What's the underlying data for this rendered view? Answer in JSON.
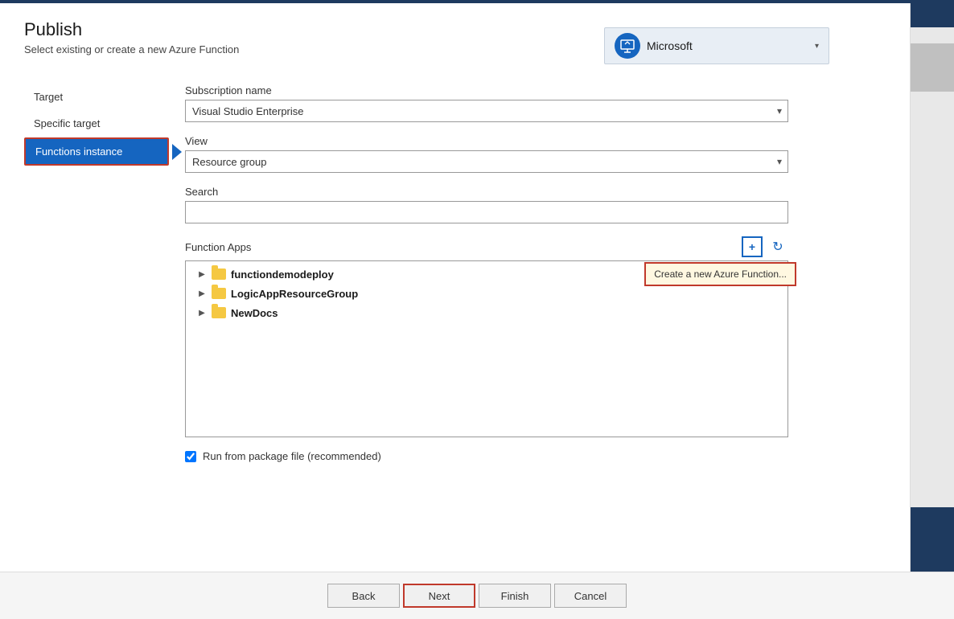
{
  "header": {
    "title": "Publish",
    "subtitle": "Select existing or create a new Azure Function",
    "account_name": "Microsoft",
    "account_icon": "👤"
  },
  "nav": {
    "items": [
      {
        "id": "target",
        "label": "Target"
      },
      {
        "id": "specific-target",
        "label": "Specific target"
      },
      {
        "id": "functions-instance",
        "label": "Functions instance",
        "active": true
      }
    ],
    "arrow_indicator": "▶"
  },
  "form": {
    "subscription_label": "Subscription name",
    "subscription_value": "Visual Studio Enterprise",
    "view_label": "View",
    "view_value": "Resource group",
    "search_label": "Search",
    "search_placeholder": "",
    "function_apps_label": "Function Apps",
    "add_icon": "+",
    "refresh_icon": "↻",
    "tooltip_text": "Create a new Azure Function...",
    "tree_items": [
      {
        "id": "item-1",
        "label": "functiondemodeploy"
      },
      {
        "id": "item-2",
        "label": "LogicAppResourceGroup"
      },
      {
        "id": "item-3",
        "label": "NewDocs"
      }
    ],
    "checkbox_label": "Run from package file (recommended)",
    "checkbox_checked": true
  },
  "buttons": {
    "back": "Back",
    "next": "Next",
    "finish": "Finish",
    "cancel": "Cancel"
  }
}
